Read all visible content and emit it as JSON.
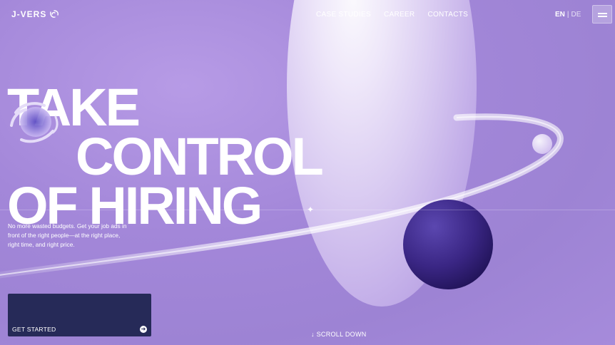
{
  "brand": {
    "name": "J-VERS",
    "logo_icon": "swirl-icon"
  },
  "nav": {
    "items": [
      "CASE STUDIES",
      "CAREER",
      "CONTACTS"
    ]
  },
  "language": {
    "active": "EN",
    "separator": "|",
    "other": "DE"
  },
  "menu": {
    "icon": "hamburger-icon"
  },
  "hero": {
    "headline_lines": [
      "TAKE",
      "CONTROL",
      "OF HIRING"
    ],
    "subtitle": "No more wasted budgets. Get your job ads in front of the right people—at the right place, right time, and right price.",
    "cta_label": "GET STARTED",
    "cta_icon": "arrow-right-icon",
    "scroll_label": "↓ SCROLL DOWN"
  },
  "colors": {
    "background": "#a387d9",
    "cta": "#262a58",
    "planet": "#3e2a8c"
  }
}
